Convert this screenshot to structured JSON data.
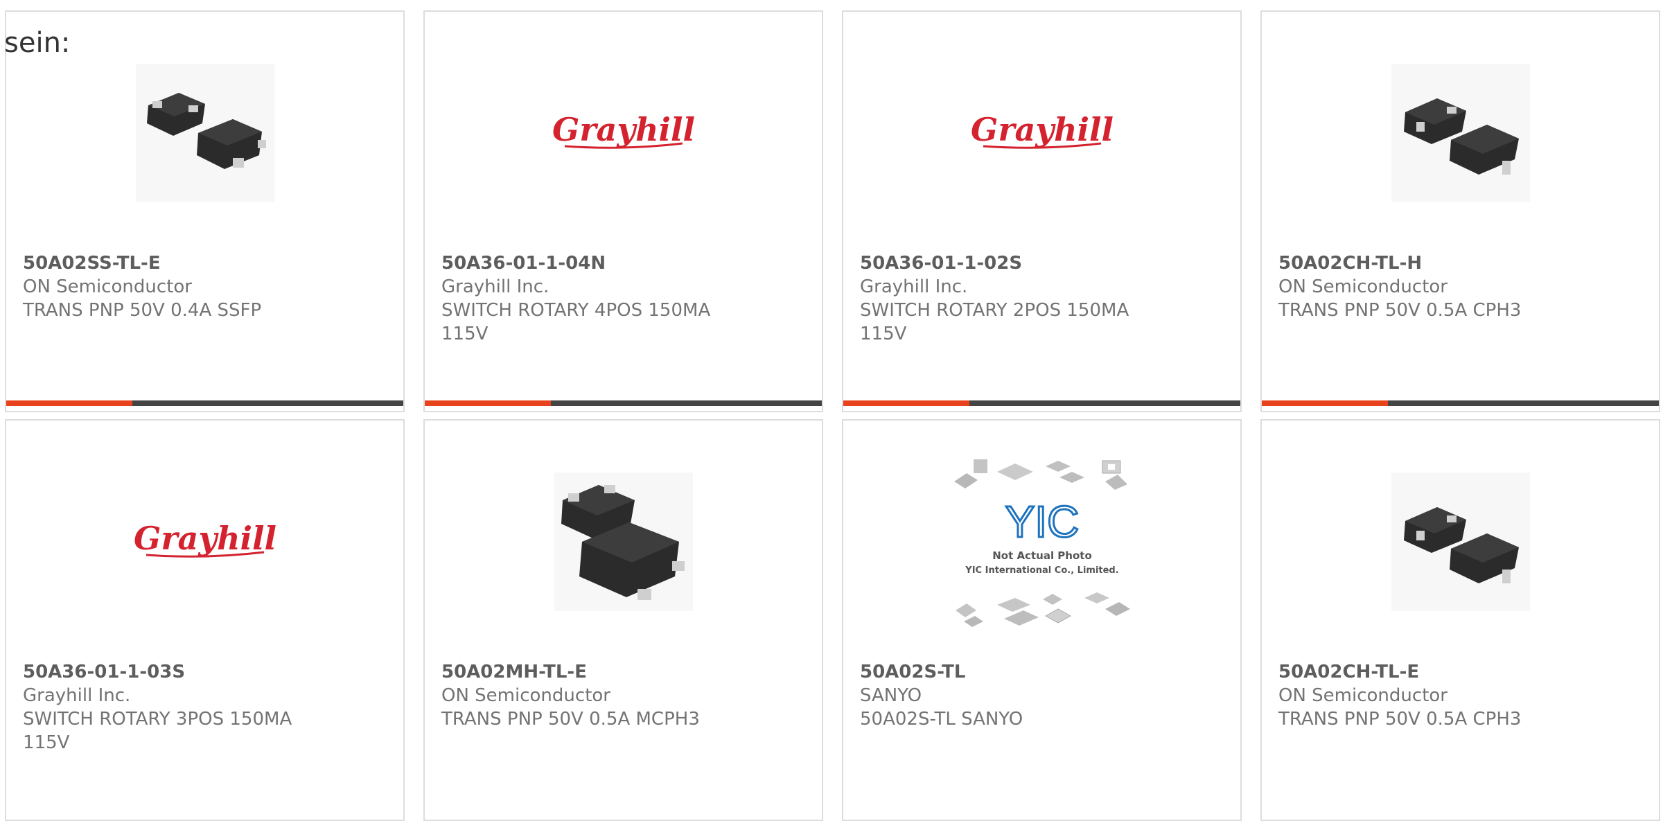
{
  "intro": {
    "text": "sein:"
  },
  "colors": {
    "accent": "#e8431d",
    "bar": "#444444",
    "card_border": "#dddddd",
    "grayhill_red": "#d4222f",
    "yic_blue": "#1e73be"
  },
  "products": [
    {
      "part_number": "50A02SS-TL-E",
      "manufacturer": "ON Semiconductor",
      "description": "TRANS PNP 50V 0.4A SSFP",
      "image": "transistor-package-image"
    },
    {
      "part_number": "50A36-01-1-04N",
      "manufacturer": "Grayhill Inc.",
      "description": "SWITCH ROTARY 4POS 150MA 115V",
      "image": "grayhill-logo",
      "logo_text": "Grayhill"
    },
    {
      "part_number": "50A36-01-1-02S",
      "manufacturer": "Grayhill Inc.",
      "description": "SWITCH ROTARY 2POS 150MA 115V",
      "image": "grayhill-logo",
      "logo_text": "Grayhill"
    },
    {
      "part_number": "50A02CH-TL-H",
      "manufacturer": "ON Semiconductor",
      "description": "TRANS PNP 50V 0.5A CPH3",
      "image": "transistor-package-image"
    },
    {
      "part_number": "50A36-01-1-03S",
      "manufacturer": "Grayhill Inc.",
      "description": "SWITCH ROTARY 3POS 150MA 115V",
      "image": "grayhill-logo",
      "logo_text": "Grayhill"
    },
    {
      "part_number": "50A02MH-TL-E",
      "manufacturer": "ON Semiconductor",
      "description": "TRANS PNP 50V 0.5A MCPH3",
      "image": "transistor-package-image"
    },
    {
      "part_number": "50A02S-TL",
      "manufacturer": "SANYO",
      "description": "50A02S-TL SANYO",
      "image": "yic-placeholder-image",
      "logo_text": "YIC",
      "caption_line1": "Not Actual Photo",
      "caption_line2": "YIC International Co., Limited."
    },
    {
      "part_number": "50A02CH-TL-E",
      "manufacturer": "ON Semiconductor",
      "description": "TRANS PNP 50V 0.5A CPH3",
      "image": "transistor-package-image"
    }
  ]
}
